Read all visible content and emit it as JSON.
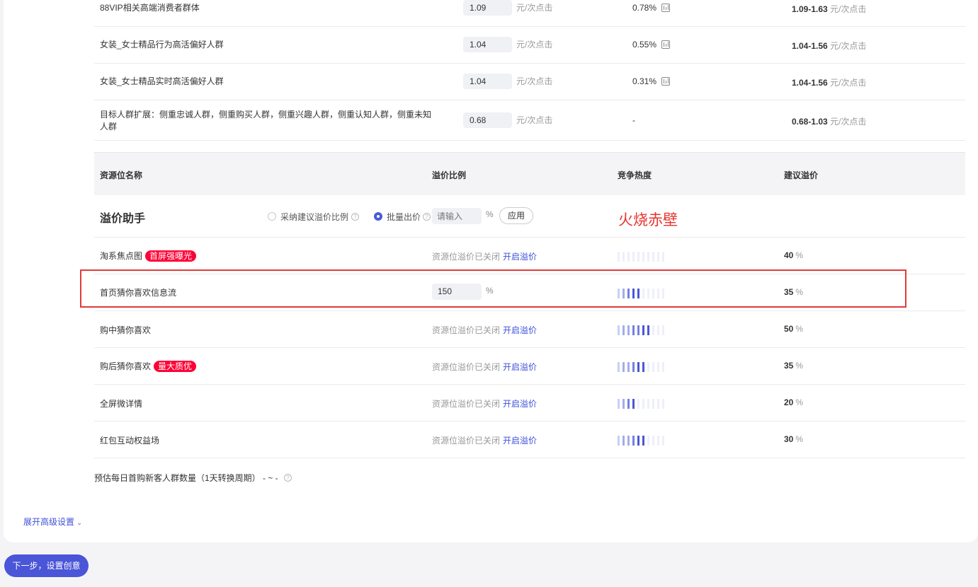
{
  "audiences": [
    {
      "name": "88VIP相关高端消费者群体",
      "bid": "1.09",
      "unit": "元/次点击",
      "rate": "0.78%",
      "range_bold": "1.09-1.63",
      "range_unit": "元/次点击"
    },
    {
      "name": "女装_女士精品行为高活偏好人群",
      "bid": "1.04",
      "unit": "元/次点击",
      "rate": "0.55%",
      "range_bold": "1.04-1.56",
      "range_unit": "元/次点击"
    },
    {
      "name": "女装_女士精品实时高活偏好人群",
      "bid": "1.04",
      "unit": "元/次点击",
      "rate": "0.31%",
      "range_bold": "1.04-1.56",
      "range_unit": "元/次点击"
    },
    {
      "name": "目标人群扩展：侧重忠诚人群，侧重购买人群，侧重兴趣人群，侧重认知人群，侧重未知人群",
      "bid": "0.68",
      "unit": "元/次点击",
      "rate": "-",
      "range_bold": "0.68-1.03",
      "range_unit": "元/次点击"
    }
  ],
  "resource_table": {
    "headers": [
      "资源位名称",
      "溢价比例",
      "竞争热度",
      "建议溢价"
    ],
    "assistant": {
      "title": "溢价助手",
      "option_adopt": "采纳建议溢价比例",
      "option_batch": "批量出价",
      "input_placeholder": "请输入",
      "percent": "%",
      "apply": "应用",
      "help": "?"
    },
    "overlay_text": "火烧赤壁",
    "rows": [
      {
        "name": "淘系焦点图",
        "tag": "首屏强曝光",
        "closed_text": "资源位溢价已关闭",
        "open_link": "开启溢价",
        "heat_level": 0,
        "suggest": "40",
        "pct": "%"
      },
      {
        "name": "首页猜你喜欢信息流",
        "tag": "",
        "bid_value": "150",
        "bid_pct": "%",
        "heat_level": 5,
        "suggest": "35",
        "pct": "%"
      },
      {
        "name": "购中猜你喜欢",
        "tag": "",
        "closed_text": "资源位溢价已关闭",
        "open_link": "开启溢价",
        "heat_level": 7,
        "suggest": "50",
        "pct": "%"
      },
      {
        "name": "购后猜你喜欢",
        "tag": "量大质优",
        "closed_text": "资源位溢价已关闭",
        "open_link": "开启溢价",
        "heat_level": 6,
        "suggest": "35",
        "pct": "%"
      },
      {
        "name": "全屏微详情",
        "tag": "",
        "closed_text": "资源位溢价已关闭",
        "open_link": "开启溢价",
        "heat_level": 4,
        "suggest": "20",
        "pct": "%"
      },
      {
        "name": "红包互动权益场",
        "tag": "",
        "closed_text": "资源位溢价已关闭",
        "open_link": "开启溢价",
        "heat_level": 6,
        "suggest": "30",
        "pct": "%"
      }
    ]
  },
  "estimate_text": "预估每日首购新客人群数量（1天转换周期） - ~ -",
  "advanced_link": "展开高级设置",
  "next_button": "下一步，设置创意",
  "colors": {
    "accent": "#4a55d8",
    "tag_red": "#ff0036",
    "highlight_red": "#e23a3a",
    "overlay_red": "#e8332f"
  }
}
